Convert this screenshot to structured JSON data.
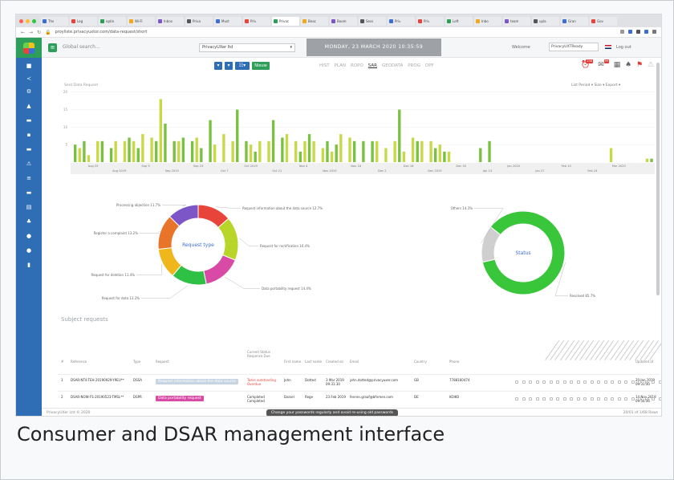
{
  "browser": {
    "tabs": [
      "The",
      "Log",
      "optin",
      "Wi-Fi",
      "Inbox",
      "Priva",
      "Must",
      "Priv",
      "Privac",
      "Beac",
      "Boom",
      "Sess",
      "Priv",
      "Priv",
      "Loft",
      "Inbo",
      "team",
      "upla",
      "Gran",
      "Gov"
    ],
    "url": "proyliste.privacyuxtor.com/data-request/short"
  },
  "app": {
    "search_placeholder": "Global search...",
    "company_selected": "PrivacyUXer ltd",
    "date_banner": "MONDAY, 23 MARCH 2020 10:35:59",
    "welcome_label": "Welcome",
    "user_selected": "PrivacyUXTReady",
    "logout_label": "Log out",
    "new_button": "Nieuw"
  },
  "subtabs": [
    "HIST",
    "PLAN",
    "ROPO",
    "SAR",
    "GEODATA",
    "PROG",
    "DPF"
  ],
  "active_subtab": "SAR",
  "badges": {
    "notifications": "238",
    "messages": "99"
  },
  "chart_legend": "Sent    Data Request",
  "chart_tools": "List   Period ▾   Size ▾   Export ▾",
  "chart_data": [
    {
      "type": "bar",
      "title": "",
      "x_tick_labels": [
        "Aug 25",
        "Aug 2019",
        "Sep 9",
        "Sep 2019",
        "Sep 23",
        "Oct 7",
        "Oct 2019",
        "Oct 21",
        "Nov 4",
        "Nov 2019",
        "Nov 18",
        "Dec 2",
        "Dec 16",
        "Dec 2019",
        "Dec 30",
        "Jan 13",
        "Jan 2020",
        "Jan 27",
        "Feb 10",
        "Feb 24",
        "Mar 2020"
      ],
      "y_tick_labels": [
        "20",
        "15",
        "10",
        "5"
      ],
      "ylim": [
        0,
        22
      ],
      "values": [
        5,
        4,
        6,
        2,
        0,
        6,
        6,
        0,
        4,
        6,
        0,
        6,
        7,
        6,
        4,
        8,
        0,
        7,
        6,
        18,
        11,
        0,
        6,
        6,
        7,
        0,
        6,
        7,
        4,
        0,
        12,
        5,
        0,
        8,
        0,
        6,
        15,
        0,
        6,
        5,
        3,
        6,
        0,
        6,
        12,
        0,
        7,
        8,
        0,
        6,
        3,
        6,
        8,
        6,
        0,
        4,
        6,
        3,
        5,
        8,
        0,
        7,
        6,
        0,
        6,
        0,
        6,
        6,
        0,
        4,
        0,
        6,
        15,
        3,
        0,
        7,
        6,
        6,
        0,
        6,
        4,
        5,
        3,
        3,
        0,
        0,
        0,
        0,
        0,
        0,
        4,
        0,
        6,
        0,
        0,
        0,
        0,
        0,
        0,
        0,
        0,
        0,
        0,
        0,
        0,
        0,
        0,
        0,
        0,
        0,
        0,
        0,
        0,
        0,
        0,
        0,
        0,
        0,
        0,
        4,
        0,
        0,
        0,
        0,
        0,
        0,
        0,
        1,
        1
      ]
    },
    {
      "type": "pie",
      "title": "Request type",
      "center_label": "Request type",
      "slices": [
        {
          "name": "Request information about the data source",
          "value": 12.7,
          "label": "Request information about the data source 12.7%"
        },
        {
          "name": "Request for rectification",
          "value": 16.4,
          "label": "Request for rectification 16.4%"
        },
        {
          "name": "Data portability request",
          "value": 14.4,
          "label": "Data portability request 14.4%"
        },
        {
          "name": "Request for data",
          "value": 13.3,
          "label": "Request for data 13.3%"
        },
        {
          "name": "Request for deletion",
          "value": 11.4,
          "label": "Request for deletion 11.4%"
        },
        {
          "name": "Register a complaint",
          "value": 13.2,
          "label": "Register a complaint 13.2%"
        },
        {
          "name": "Processing objection",
          "value": 11.7,
          "label": "Processing objection 11.7%"
        }
      ]
    },
    {
      "type": "pie",
      "title": "Status",
      "center_label": "Status",
      "slices": [
        {
          "name": "Resolved",
          "value": 85.7,
          "label": "Resolved 85.7%"
        },
        {
          "name": "Others",
          "value": 14.3,
          "label": "Others 14.3%"
        }
      ]
    }
  ],
  "table": {
    "title": "Subject requests",
    "headers": [
      "#",
      "Reference",
      "Type",
      "Request",
      "Current Status Response Due",
      "First name",
      "Last name",
      "Created on",
      "Email",
      "Country",
      "Phone",
      "Updated at"
    ],
    "rows": [
      {
        "n": "1",
        "ref": "DSAR-NT4-TEH-20190929-Y9EU**",
        "type": "DSSA",
        "request": "Request information about the data source",
        "status": "Tasks outstanding Overdue",
        "first": "John",
        "last": "Dotted",
        "created": "3 Mar 2019 09:31:30",
        "email": "john.dotted@privacyuxer.com",
        "country": "GB",
        "phone": "7788160474",
        "updated": "20 Jan 2019 09:31:30"
      },
      {
        "n": "2",
        "ref": "DSAR-NOW-FS-20190523-TMSL**",
        "type": "DSPR",
        "request": "Data portability request",
        "status": "Completed Completed",
        "first": "Daniel",
        "last": "Rege",
        "created": "23 Feb 2019",
        "email": "fenren.graaf@bfnmen.com",
        "country": "DE",
        "phone": "KOIKO",
        "updated": "14 Nov 2019 09:56:36"
      }
    ]
  },
  "footer": {
    "left": "PrivacyUXer Ltd © 2020",
    "toast": "Change your passwords regularly and avoid re-using old passwords",
    "right": "20/01 of 1/68 Rows"
  },
  "caption": "Consumer and DSAR management interface",
  "colors": {
    "sidebar": "#2f6db5",
    "brand_green": "#2e9e5b",
    "bar_palette": [
      "#7ac142",
      "#e8443a",
      "#f0a81c",
      "#c8d948",
      "#7c56c6",
      "#2fc046",
      "#d94aa6"
    ]
  }
}
